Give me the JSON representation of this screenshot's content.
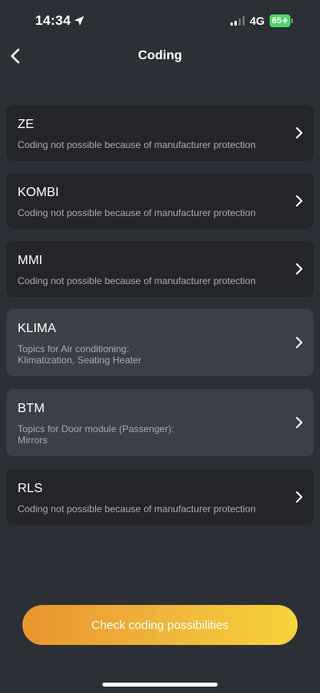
{
  "status_bar": {
    "time": "14:34",
    "network": "4G",
    "battery": "65",
    "battery_color": "#4cd964"
  },
  "header": {
    "title": "Coding"
  },
  "modules": [
    {
      "name": "ZE",
      "description": "Coding not possible because of manufacturer protection",
      "state": "disabled"
    },
    {
      "name": "KOMBI",
      "description": "Coding not possible because of manufacturer protection",
      "state": "disabled"
    },
    {
      "name": "MMI",
      "description": "Coding not possible because of manufacturer protection",
      "state": "disabled"
    },
    {
      "name": "KLIMA",
      "description": "Topics for Air conditioning:\nKlimatization, Seating Heater",
      "state": "available"
    },
    {
      "name": "BTM",
      "description": "Topics for Door module (Passenger):\nMirrors",
      "state": "available"
    },
    {
      "name": "RLS",
      "description": "Coding not possible because of manufacturer protection",
      "state": "disabled"
    }
  ],
  "cta": {
    "label": "Check coding possibilities",
    "gradient": [
      "#e8952e",
      "#f6d43a"
    ]
  },
  "icons": {
    "back": "chevron-left-icon",
    "row": "chevron-right-icon",
    "location": "location-arrow-icon",
    "signal": "cellular-signal-icon",
    "battery": "battery-charging-icon"
  }
}
